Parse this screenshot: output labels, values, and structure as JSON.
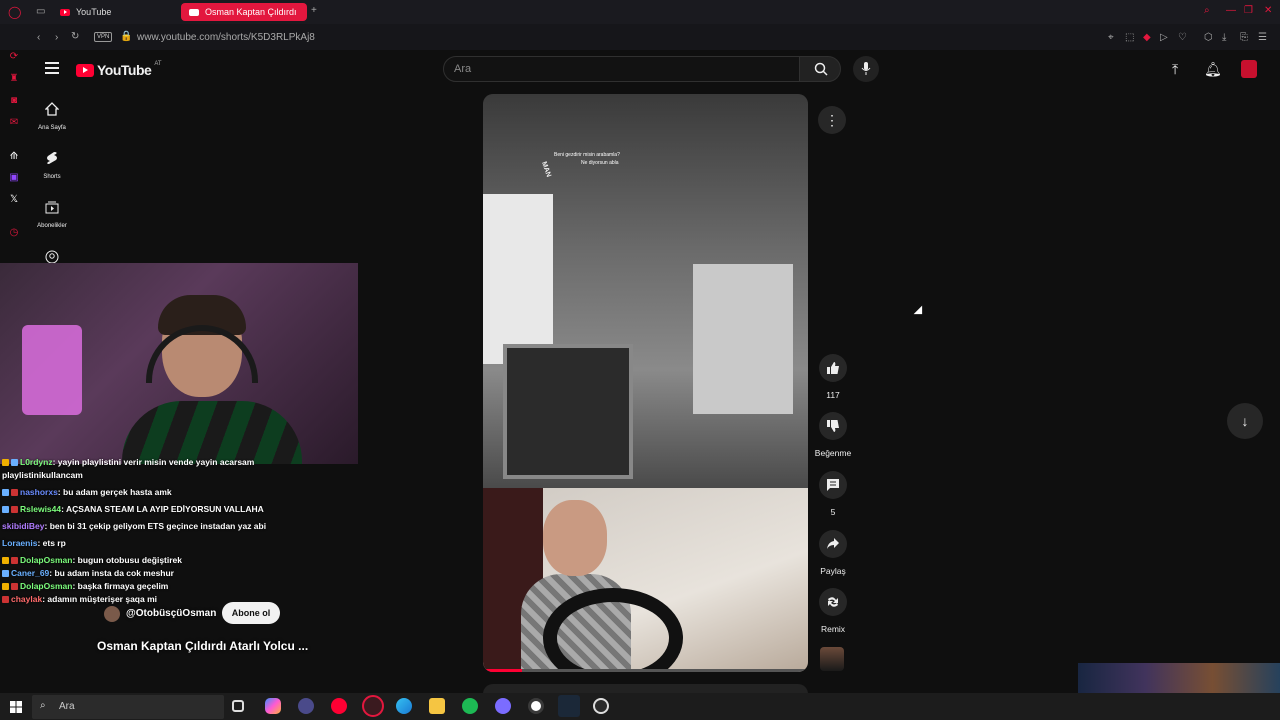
{
  "browser": {
    "tabs": [
      {
        "label": "YouTube"
      },
      {
        "label": "Osman Kaptan Çıldırdı"
      }
    ],
    "vpn_label": "VPN",
    "url": "www.youtube.com/shorts/K5D3RLPkAj8"
  },
  "youtube": {
    "logo_text": "YouTube",
    "logo_region": "AT",
    "search_placeholder": "Ara",
    "sidebar": [
      {
        "label": "Ana Sayfa",
        "icon": "home-icon"
      },
      {
        "label": "Shorts",
        "icon": "shorts-icon"
      },
      {
        "label": "Abonelikler",
        "icon": "subscriptions-icon"
      }
    ]
  },
  "short": {
    "game_subtitle_1": "Beni gezdirir misin arabamla?",
    "game_subtitle_2": "Ne diyorsun abla",
    "truck_brand": "MAN",
    "title": "Osman Kaptan Çıldırdı Atarlı Yolcu ...",
    "channel": "@OtobüsçüOsman",
    "subscribe_label": "Abone ol",
    "progress_percent": 12,
    "actions": {
      "like_count": "117",
      "dislike_label": "Beğenme",
      "comment_count": "5",
      "share_label": "Paylaş",
      "remix_label": "Remix"
    }
  },
  "chat": [
    {
      "user": "L0rdynz",
      "message": "yayin playlistini verir misin vende yayin acarsam playlistinikullancam",
      "color": "#7cfc7c"
    },
    {
      "user": "nashorxs",
      "message": "bu adam gerçek hasta amk",
      "color": "#6a8cff"
    },
    {
      "user": "Rslewis44",
      "message": "AÇSANA STEAM LA AYIP EDİYORSUN VALLAHA",
      "color": "#7cfc7c"
    },
    {
      "user": "skibidiBey",
      "message": "ben bi 31 çekip geliyom ETS geçince instadan yaz abi",
      "color": "#b07cff"
    },
    {
      "user": "Loraenis",
      "message": "ets rp",
      "color": "#6ab0ff"
    },
    {
      "user": "DolapOsman",
      "message": "bugun otobusu değiştirek",
      "color": "#7cfc7c"
    },
    {
      "user": "Caner_69",
      "message": "bu adam insta da cok meshur",
      "color": "#6ab0ff"
    },
    {
      "user": "DolapOsman",
      "message": "başka firmaya geçelim",
      "color": "#7cfc7c"
    },
    {
      "user": "chaylak",
      "message": "adamın müşterişer şaqa mi",
      "color": "#ff6a6a"
    }
  ],
  "taskbar": {
    "search_placeholder": "Ara"
  },
  "colors": {
    "accent": "#ff0033",
    "opera": "#e3173e"
  }
}
